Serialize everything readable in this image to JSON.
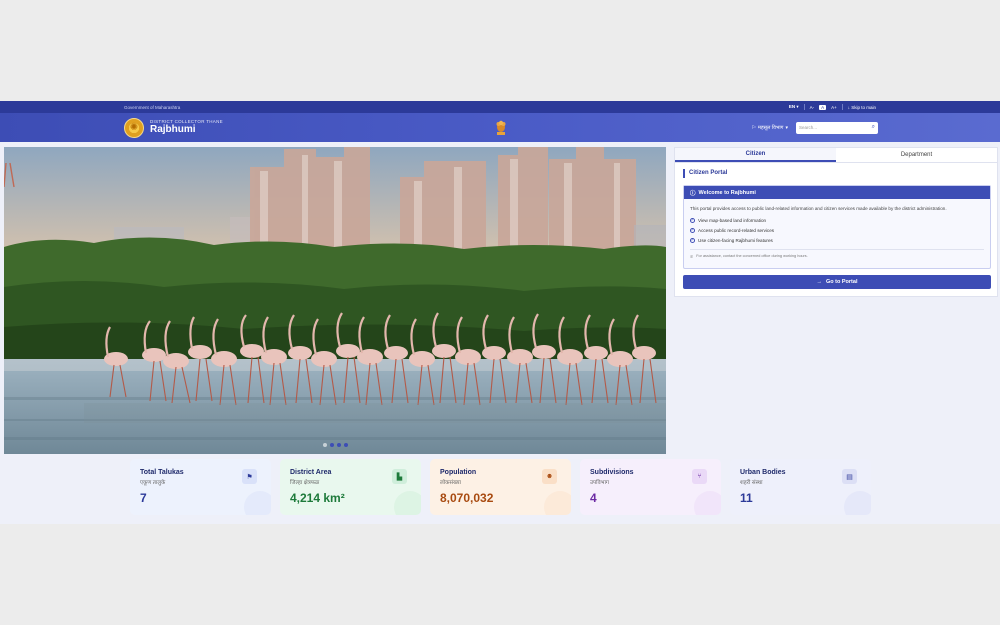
{
  "topbar": {
    "gov_label": "Government of Maharashtra",
    "lang": "EN ▾",
    "font_small": "A-",
    "font_normal": "A",
    "font_large": "A+",
    "skip": "↓ Skip to main"
  },
  "header": {
    "subtitle": "DISTRICT COLLECTOR THANE",
    "title": "Rajbhumi",
    "dept_select": "महसूल विभाग",
    "search_placeholder": "Search..."
  },
  "hero": {
    "slides": 4,
    "active_slide": 1
  },
  "portal": {
    "tabs": [
      "Citizen",
      "Department"
    ],
    "active_tab": "Citizen",
    "title": "Citizen Portal",
    "card_title": "Welcome to Rajbhumi",
    "description": "This portal provides access to public land-related information and citizen services made available by the district administration.",
    "features": [
      "View map-based land information",
      "Access public record-related services",
      "Use citizen-facing Rajbhumi features"
    ],
    "note": "For assistance, contact the concerned office during working hours.",
    "button": "Go to Portal"
  },
  "stats": [
    {
      "title": "Total Talukas",
      "marathi": "एकूण तालुके",
      "value": "7",
      "icon": "flag-icon"
    },
    {
      "title": "District Area",
      "marathi": "जिल्हा क्षेत्रफळ",
      "value": "4,214 km²",
      "icon": "area-icon"
    },
    {
      "title": "Population",
      "marathi": "लोकसंख्या",
      "value": "8,070,032",
      "icon": "people-icon"
    },
    {
      "title": "Subdivisions",
      "marathi": "उपविभाग",
      "value": "4",
      "icon": "branch-icon"
    },
    {
      "title": "Urban Bodies",
      "marathi": "शहरी संस्था",
      "value": "11",
      "icon": "building-icon"
    }
  ]
}
